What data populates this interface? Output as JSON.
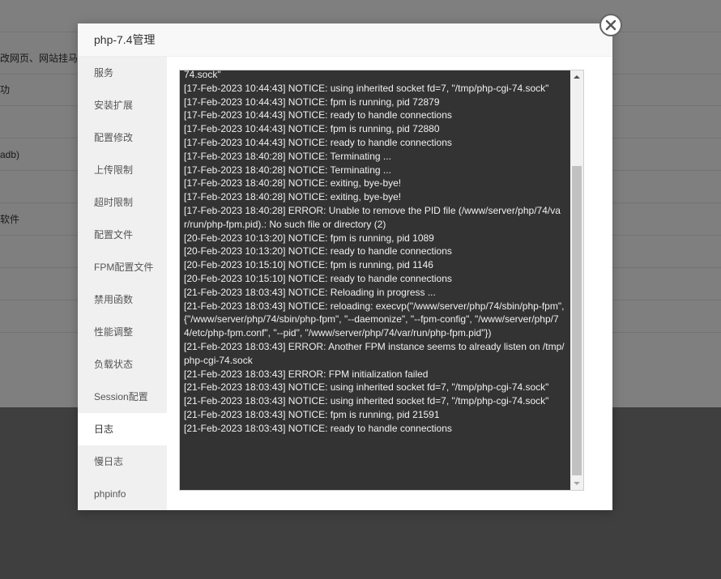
{
  "background": {
    "rows": [
      "",
      "改网页、网站挂马",
      "功",
      "",
      "adb)",
      "",
      "软件",
      "",
      "",
      ""
    ]
  },
  "modal": {
    "title": "php-7.4管理"
  },
  "sidebar": {
    "items": [
      {
        "label": "服务",
        "active": false
      },
      {
        "label": "安装扩展",
        "active": false
      },
      {
        "label": "配置修改",
        "active": false
      },
      {
        "label": "上传限制",
        "active": false
      },
      {
        "label": "超时限制",
        "active": false
      },
      {
        "label": "配置文件",
        "active": false
      },
      {
        "label": "FPM配置文件",
        "active": false
      },
      {
        "label": "禁用函数",
        "active": false
      },
      {
        "label": "性能调整",
        "active": false
      },
      {
        "label": "负载状态",
        "active": false
      },
      {
        "label": "Session配置",
        "active": false
      },
      {
        "label": "日志",
        "active": true
      },
      {
        "label": "慢日志",
        "active": false
      },
      {
        "label": "phpinfo",
        "active": false
      }
    ]
  },
  "log": {
    "text": "74.sock\"\n[17-Feb-2023 10:44:43] NOTICE: using inherited socket fd=7, \"/tmp/php-cgi-74.sock\"\n[17-Feb-2023 10:44:43] NOTICE: fpm is running, pid 72879\n[17-Feb-2023 10:44:43] NOTICE: ready to handle connections\n[17-Feb-2023 10:44:43] NOTICE: fpm is running, pid 72880\n[17-Feb-2023 10:44:43] NOTICE: ready to handle connections\n[17-Feb-2023 18:40:28] NOTICE: Terminating ...\n[17-Feb-2023 18:40:28] NOTICE: Terminating ...\n[17-Feb-2023 18:40:28] NOTICE: exiting, bye-bye!\n[17-Feb-2023 18:40:28] NOTICE: exiting, bye-bye!\n[17-Feb-2023 18:40:28] ERROR: Unable to remove the PID file (/www/server/php/74/var/run/php-fpm.pid).: No such file or directory (2)\n[20-Feb-2023 10:13:20] NOTICE: fpm is running, pid 1089\n[20-Feb-2023 10:13:20] NOTICE: ready to handle connections\n[20-Feb-2023 10:15:10] NOTICE: fpm is running, pid 1146\n[20-Feb-2023 10:15:10] NOTICE: ready to handle connections\n[21-Feb-2023 18:03:43] NOTICE: Reloading in progress ...\n[21-Feb-2023 18:03:43] NOTICE: reloading: execvp(\"/www/server/php/74/sbin/php-fpm\", {\"/www/server/php/74/sbin/php-fpm\", \"--daemonize\", \"--fpm-config\", \"/www/server/php/74/etc/php-fpm.conf\", \"--pid\", \"/www/server/php/74/var/run/php-fpm.pid\"})\n[21-Feb-2023 18:03:43] ERROR: Another FPM instance seems to already listen on /tmp/php-cgi-74.sock\n[21-Feb-2023 18:03:43] ERROR: FPM initialization failed\n[21-Feb-2023 18:03:43] NOTICE: using inherited socket fd=7, \"/tmp/php-cgi-74.sock\"\n[21-Feb-2023 18:03:43] NOTICE: using inherited socket fd=7, \"/tmp/php-cgi-74.sock\"\n[21-Feb-2023 18:03:43] NOTICE: fpm is running, pid 21591\n[21-Feb-2023 18:03:43] NOTICE: ready to handle connections"
  },
  "icons": {
    "close": "close-icon",
    "scroll_up": "triangle-up-icon",
    "scroll_down": "triangle-down-icon"
  }
}
